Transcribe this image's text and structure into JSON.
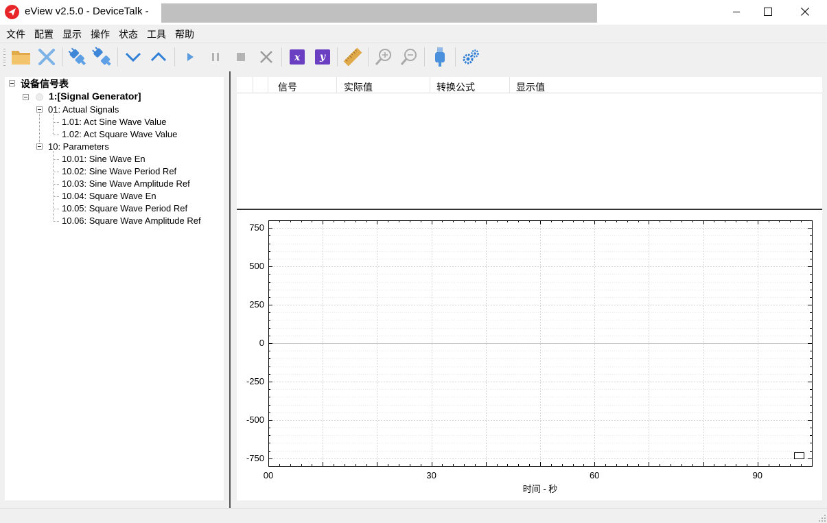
{
  "window": {
    "title": "eView v2.5.0 - DeviceTalk  -",
    "controls": [
      "minimize",
      "maximize",
      "close"
    ]
  },
  "menu": [
    "文件",
    "配置",
    "显示",
    "操作",
    "状态",
    "工具",
    "帮助"
  ],
  "toolbar": [
    {
      "icon": "folder-open-icon"
    },
    {
      "icon": "close-x-icon"
    },
    {
      "icon": "connect-icon"
    },
    {
      "icon": "disconnect-icon"
    },
    {
      "icon": "chevron-down-icon"
    },
    {
      "icon": "chevron-up-icon"
    },
    {
      "icon": "play-icon"
    },
    {
      "icon": "pause-icon"
    },
    {
      "icon": "stop-icon"
    },
    {
      "icon": "clear-icon"
    },
    {
      "icon": "x-axis-icon",
      "label": "x"
    },
    {
      "icon": "y-axis-icon",
      "label": "y"
    },
    {
      "icon": "ruler-icon"
    },
    {
      "icon": "zoom-in-icon"
    },
    {
      "icon": "zoom-out-icon"
    },
    {
      "icon": "usb-icon"
    },
    {
      "icon": "settings-gears-icon"
    }
  ],
  "tree": {
    "root": "设备信号表",
    "device": "1:[Signal Generator]",
    "groups": [
      {
        "label": "01: Actual Signals",
        "items": [
          "1.01: Act Sine Wave Value",
          "1.02: Act Square Wave Value"
        ]
      },
      {
        "label": "10: Parameters",
        "items": [
          "10.01: Sine Wave En",
          "10.02: Sine Wave Period Ref",
          "10.03: Sine Wave Amplitude Ref",
          "10.04: Square Wave En",
          "10.05: Square Wave Period Ref",
          "10.06: Square Wave Amplitude Ref"
        ]
      }
    ]
  },
  "signal_table": {
    "columns": [
      "信号",
      "实际值",
      "转换公式",
      "显示值"
    ],
    "rows": []
  },
  "chart_data": {
    "type": "line",
    "series": [],
    "xlabel": "时间 - 秒",
    "xlim": [
      0,
      100
    ],
    "ylim": [
      -800,
      800
    ],
    "x_ticks": [
      "00",
      "30",
      "60",
      "90"
    ],
    "y_ticks": [
      "750",
      "500",
      "250",
      "0",
      "-250",
      "-500",
      "-750"
    ],
    "grid": true
  },
  "colors": {
    "accent": "#2f7fd6",
    "brand": "#e8262a",
    "axis_button": "#6a3fc2",
    "ruler": "#e0a94a"
  }
}
